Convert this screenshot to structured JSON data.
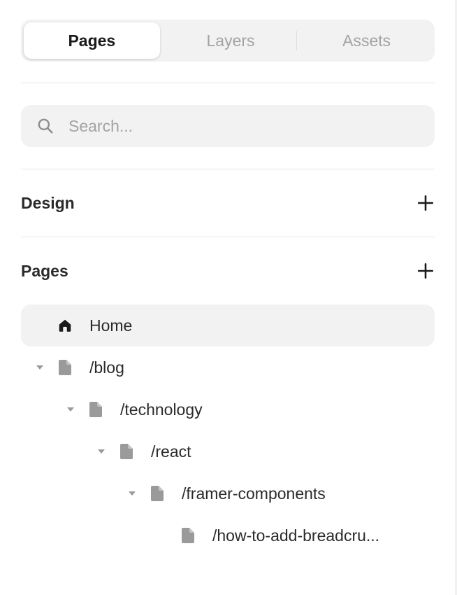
{
  "tabs": [
    {
      "label": "Pages",
      "active": true
    },
    {
      "label": "Layers",
      "active": false
    },
    {
      "label": "Assets",
      "active": false
    }
  ],
  "search": {
    "placeholder": "Search...",
    "value": ""
  },
  "sections": {
    "design": {
      "title": "Design"
    },
    "pages": {
      "title": "Pages"
    }
  },
  "tree": [
    {
      "label": "Home",
      "icon": "home-icon",
      "selected": true,
      "expandable": false
    },
    {
      "label": "/blog",
      "icon": "page-icon",
      "selected": false,
      "expandable": true
    },
    {
      "label": "/technology",
      "icon": "page-icon",
      "selected": false,
      "expandable": true
    },
    {
      "label": "/react",
      "icon": "page-icon",
      "selected": false,
      "expandable": true
    },
    {
      "label": "/framer-components",
      "icon": "page-icon",
      "selected": false,
      "expandable": true
    },
    {
      "label": "/how-to-add-breadcru...",
      "icon": "page-icon",
      "selected": false,
      "expandable": false
    }
  ],
  "colors": {
    "panel_bg": "#f2f2f2",
    "text": "#2a2a2a",
    "muted": "#a3a3a3",
    "icon": "#9a9a9a"
  }
}
